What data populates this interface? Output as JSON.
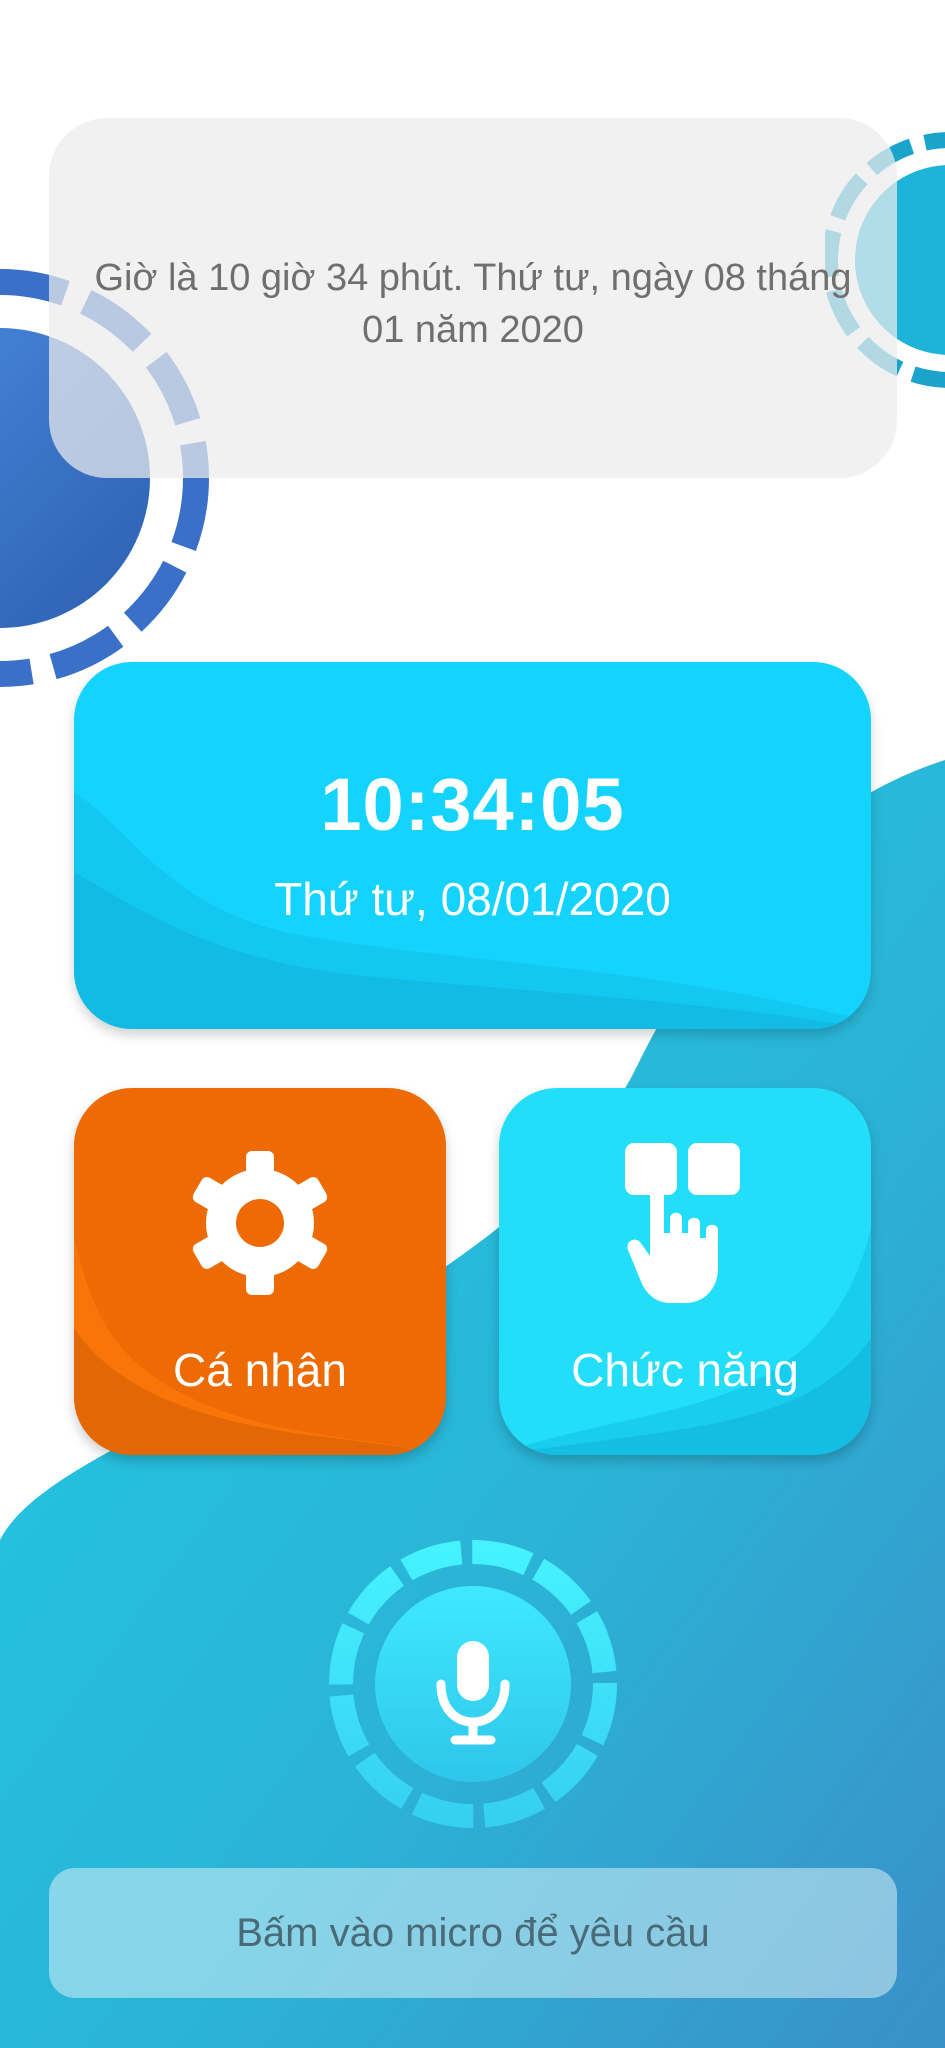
{
  "assistant_message": "Giờ là 10 giờ 34 phút. Thứ tư, ngày 08 tháng 01 năm 2020",
  "clock": {
    "time": "10:34:05",
    "date": "Thứ tư, 08/01/2020"
  },
  "tiles": [
    {
      "label": "Cá nhân",
      "icon": "gear-icon",
      "color": "#ed6a05"
    },
    {
      "label": "Chức năng",
      "icon": "tap-grid-icon",
      "color": "#22def9"
    }
  ],
  "mic": {
    "icon": "microphone-icon"
  },
  "prompt": {
    "text": "Bấm vào micro để yêu cầu"
  },
  "colors": {
    "accent": "#14d3fc",
    "orange": "#ed6a05",
    "blue_deco": "#3a78d0"
  }
}
